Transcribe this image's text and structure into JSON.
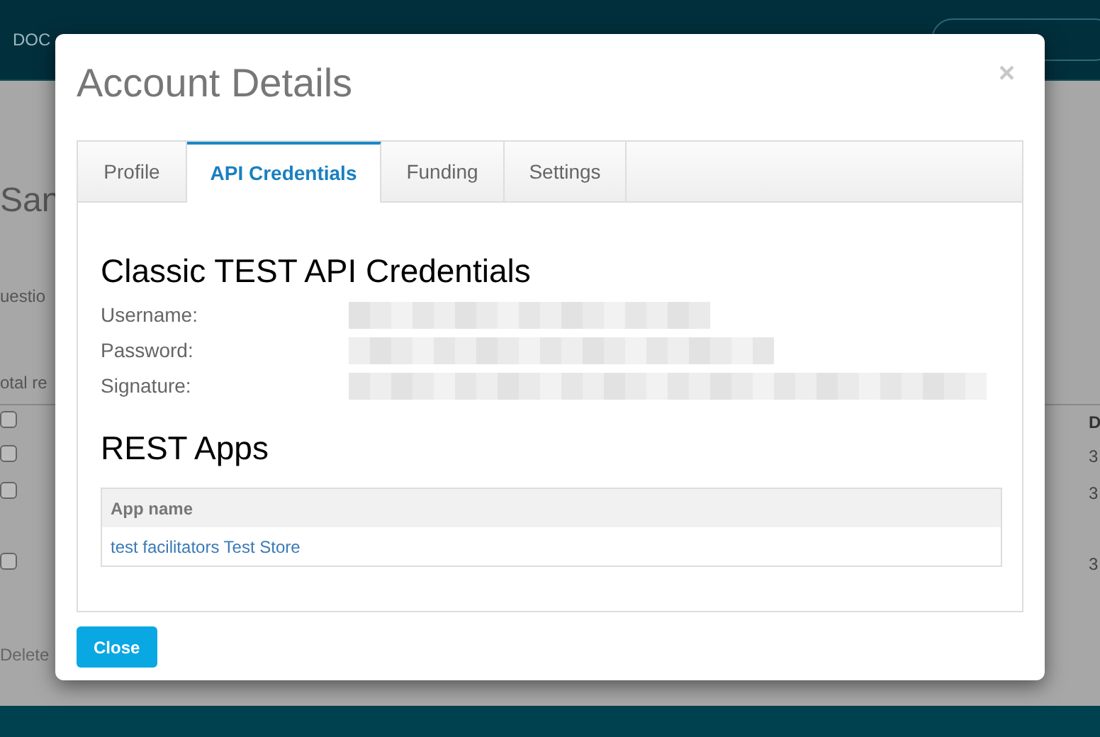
{
  "background_page": {
    "nav": [
      {
        "label": "DOC"
      }
    ],
    "heading": "San",
    "texts": [
      "uestio",
      "otal re"
    ],
    "table": {
      "column_header": "D",
      "header_checked": false,
      "rows": [
        {
          "checked": false,
          "cell": "3"
        },
        {
          "checked": false,
          "cell": "3"
        },
        {
          "checked": false,
          "cell": "3"
        }
      ]
    },
    "delete_label": "Delete"
  },
  "dialog": {
    "title": "Account Details",
    "close_icon": "×",
    "tabs": [
      {
        "label": "Profile",
        "selected": false
      },
      {
        "label": "API Credentials",
        "selected": true
      },
      {
        "label": "Funding",
        "selected": false
      },
      {
        "label": "Settings",
        "selected": false
      }
    ],
    "classic_heading": "Classic TEST API Credentials",
    "fields": [
      {
        "label": "Username:",
        "kind": "redacted"
      },
      {
        "label": "Password:",
        "kind": "redacted"
      },
      {
        "label": "Signature:",
        "kind": "redacted"
      }
    ],
    "rest_heading": "REST Apps",
    "apps_table": {
      "columns": [
        "App name"
      ],
      "rows": [
        {
          "app_name": "test facilitators Test Store"
        }
      ]
    },
    "buttons": [
      "Close"
    ]
  }
}
